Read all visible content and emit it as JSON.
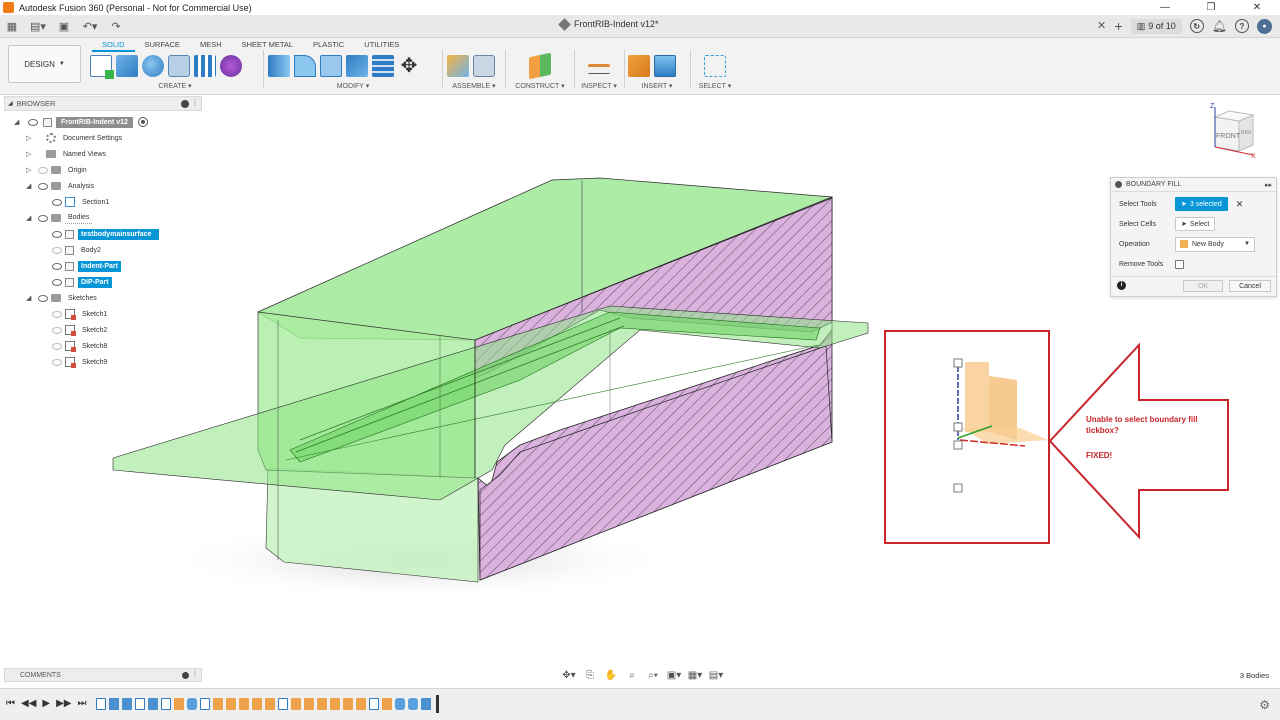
{
  "window": {
    "title": "Autodesk Fusion 360 (Personal - Not for Commercial Use)",
    "controls": [
      "—",
      "❐",
      "✕"
    ]
  },
  "quick_access": {
    "doc_tab_title": "FrontRIB-Indent v12*",
    "jobs_label": "9 of 10"
  },
  "toolbar": {
    "workspace_label": "DESIGN",
    "tabs": [
      "SOLID",
      "SURFACE",
      "MESH",
      "SHEET METAL",
      "PLASTIC",
      "UTILITIES"
    ],
    "active_tab": "SOLID",
    "groups": {
      "create": "CREATE",
      "modify": "MODIFY",
      "assemble": "ASSEMBLE",
      "construct": "CONSTRUCT",
      "inspect": "INSPECT",
      "insert": "INSERT",
      "select": "SELECT"
    }
  },
  "browser": {
    "header": "BROWSER",
    "root": "FrontRIB-Indent v12",
    "items": [
      {
        "label": "Document Settings"
      },
      {
        "label": "Named Views"
      },
      {
        "label": "Origin"
      },
      {
        "label": "Analysis"
      },
      {
        "label": "Section1"
      },
      {
        "label": "Bodies"
      },
      {
        "label": "testbodymainsurface"
      },
      {
        "label": "Body2"
      },
      {
        "label": "Indent-Part"
      },
      {
        "label": "DIP-Part"
      },
      {
        "label": "Sketches"
      },
      {
        "label": "Sketch1"
      },
      {
        "label": "Sketch2"
      },
      {
        "label": "Sketch8"
      },
      {
        "label": "Sketch9"
      }
    ]
  },
  "boundary_fill": {
    "title": "BOUNDARY FILL",
    "select_tools_label": "Select Tools",
    "select_tools_value": "3 selected",
    "select_cells_label": "Select Cells",
    "select_cells_value": "Select",
    "operation_label": "Operation",
    "operation_value": "New Body",
    "remove_tools_label": "Remove Tools",
    "ok_label": "OK",
    "cancel_label": "Cancel"
  },
  "viewcube": {
    "axis_z": "Z",
    "axis_x": "X",
    "face_front": "FRONT",
    "face_right": "RIGHT"
  },
  "annotation": {
    "text": "Unable to select boundary fill tickbox?",
    "fixed": "FIXED!"
  },
  "comments": {
    "label": "COMMENTS"
  },
  "status": {
    "body_count": "3 Bodies"
  },
  "colors": {
    "accent": "#0696d7",
    "body_green": "#7fe07a",
    "section_pink": "#d6a8dc",
    "annotation_red": "#c8242a"
  }
}
